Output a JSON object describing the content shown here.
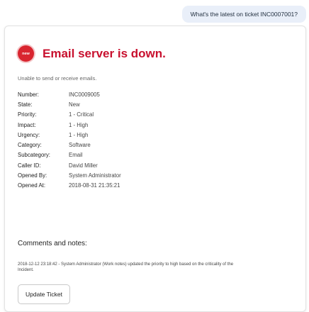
{
  "user_message": "What's the latest on ticket INC0007001?",
  "incident": {
    "badge": "new",
    "title": "Email server is down.",
    "description": "Unable to send or receive emails.",
    "fields": [
      {
        "label": "Number:",
        "value": "INC0009005"
      },
      {
        "label": "State:",
        "value": "New"
      },
      {
        "label": "Priority:",
        "value": "1 - Critical"
      },
      {
        "label": "Impact:",
        "value": "1 - High"
      },
      {
        "label": "Urgency:",
        "value": "1 - High"
      },
      {
        "label": "Category:",
        "value": "Software"
      },
      {
        "label": "Subcategory:",
        "value": "Email"
      },
      {
        "label": "Caller ID:",
        "value": "David Miller"
      },
      {
        "label": "Opened By:",
        "value": "System Administrator"
      },
      {
        "label": "Opened At:",
        "value": "2018-08-31 21:35:21"
      }
    ],
    "comments_heading": "Comments and notes:",
    "comment_text": "2018-12-12 23:18:42 - System Administrator (Work notes) updated the priority to high based on the criticality of the Incident.",
    "update_button": "Update Ticket"
  },
  "colors": {
    "accent_red": "#c8102e",
    "badge_red": "#d9252f",
    "user_bubble": "#e9eff9"
  }
}
